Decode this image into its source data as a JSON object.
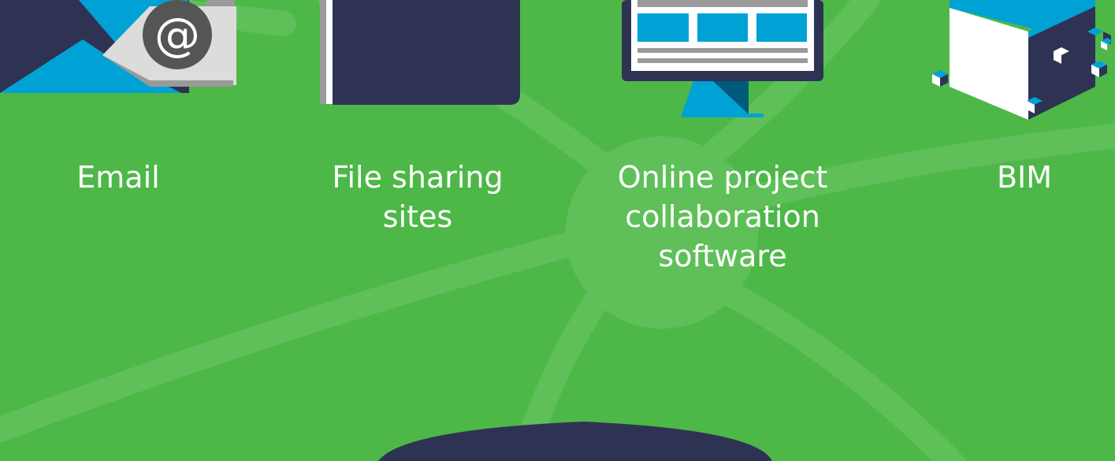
{
  "colors": {
    "background": "#4db848",
    "network_lines": "#5fc059",
    "navy": "#2f3353",
    "blue": "#00a2d6",
    "gray": "#9a9a9a",
    "light_gray": "#dcdcdc",
    "white": "#ffffff"
  },
  "channels": [
    {
      "id": "email",
      "icon": "envelope-at-icon",
      "label_lines": [
        "Email"
      ],
      "at_symbol": "@"
    },
    {
      "id": "file-sharing",
      "icon": "folder-book-icon",
      "label_lines": [
        "File sharing",
        "sites"
      ]
    },
    {
      "id": "online-collab",
      "icon": "monitor-icon",
      "label_lines": [
        "Online project",
        "collaboration",
        "software"
      ]
    },
    {
      "id": "bim",
      "icon": "cube-icon",
      "label_lines": [
        "BIM"
      ]
    }
  ]
}
